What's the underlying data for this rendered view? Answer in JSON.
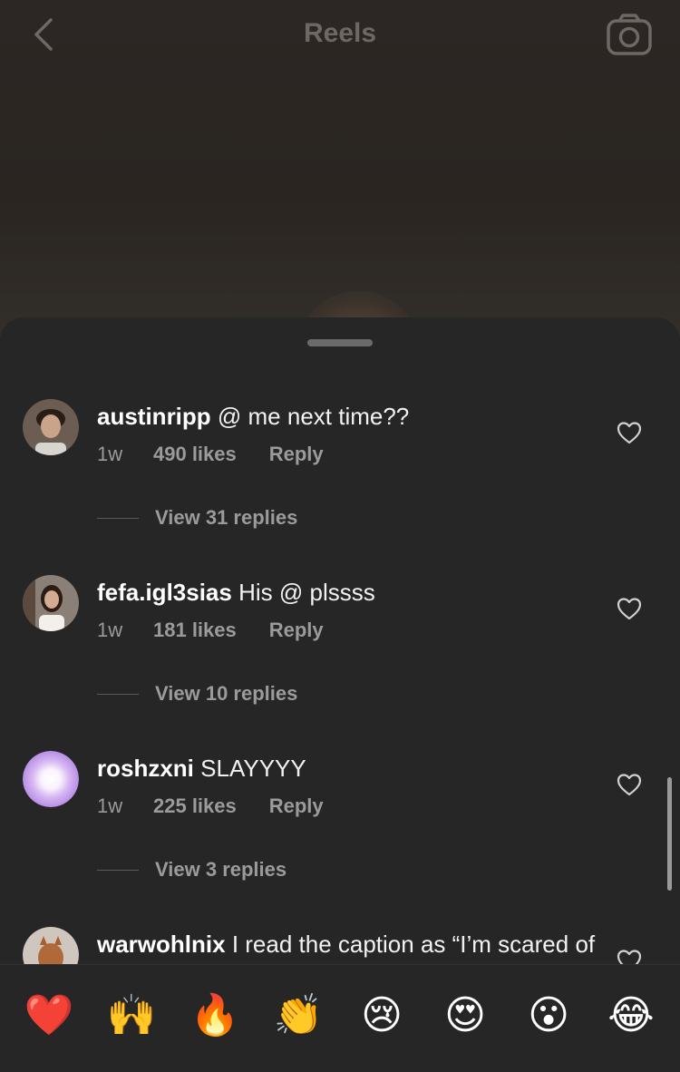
{
  "header": {
    "title": "Reels",
    "back_icon": "chevron-left-icon",
    "camera_icon": "camera-icon"
  },
  "comments": [
    {
      "username": "austinripp",
      "text": "@ me next time??",
      "time": "1w",
      "likes": "490 likes",
      "reply": "Reply",
      "view_replies": "View 31 replies"
    },
    {
      "username": "fefa.igl3sias",
      "text": "His @ plssss",
      "time": "1w",
      "likes": "181 likes",
      "reply": "Reply",
      "view_replies": "View 10 replies"
    },
    {
      "username": "roshzxni",
      "text": "SLAYYYY",
      "time": "1w",
      "likes": "225 likes",
      "reply": "Reply",
      "view_replies": "View 3 replies"
    },
    {
      "username": "warwohlnix",
      "text": "I read the caption as “I’m scared of this post” I was about to start"
    }
  ],
  "emoji_bar": [
    "❤️",
    "🙌",
    "🔥",
    "👏",
    "😢",
    "😍",
    "😮",
    "😂"
  ],
  "colors": {
    "sheet_bg": "#262626",
    "secondary_text": "#9b9b9b",
    "title_text": "#6d6863"
  }
}
